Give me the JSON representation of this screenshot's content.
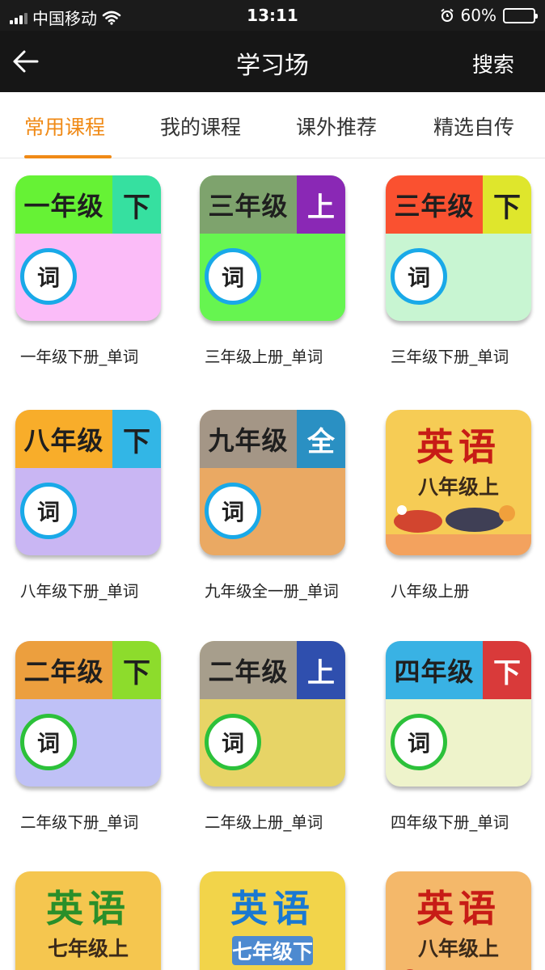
{
  "status_bar": {
    "carrier": "中国移动",
    "time": "13:11",
    "battery_text": "60%",
    "battery_level": 0.6,
    "battery_color": "#f6c100"
  },
  "nav": {
    "back_icon": "arrow-left-icon",
    "title": "学习场",
    "search_label": "搜索"
  },
  "tabs": [
    {
      "label": "常用课程",
      "active": true
    },
    {
      "label": "我的课程",
      "active": false
    },
    {
      "label": "课外推荐",
      "active": false
    },
    {
      "label": "精选自传",
      "active": false
    }
  ],
  "accent_color": "#f08a16",
  "courses": [
    {
      "label": "一年级下册_单词",
      "cover_type": "vocab",
      "grade": "一年级",
      "term": "下",
      "word": "词"
    },
    {
      "label": "三年级上册_单词",
      "cover_type": "vocab",
      "grade": "三年级",
      "term": "上",
      "word": "词"
    },
    {
      "label": "三年级下册_单词",
      "cover_type": "vocab",
      "grade": "三年级",
      "term": "下",
      "word": "词"
    },
    {
      "label": "八年级下册_单词",
      "cover_type": "vocab",
      "grade": "八年级",
      "term": "下",
      "word": "词"
    },
    {
      "label": "九年级全一册_单词",
      "cover_type": "vocab",
      "grade": "九年级",
      "term": "全",
      "word": "词"
    },
    {
      "label": "八年级上册",
      "cover_type": "textbook",
      "title": "英语",
      "subtitle": "八年级上"
    },
    {
      "label": "二年级下册_单词",
      "cover_type": "vocab",
      "grade": "二年级",
      "term": "下",
      "word": "词"
    },
    {
      "label": "二年级上册_单词",
      "cover_type": "vocab",
      "grade": "二年级",
      "term": "上",
      "word": "词"
    },
    {
      "label": "四年级下册_单词",
      "cover_type": "vocab",
      "grade": "四年级",
      "term": "下",
      "word": "词"
    },
    {
      "label": "",
      "cover_type": "textbook",
      "title": "英语",
      "subtitle": "七年级上"
    },
    {
      "label": "",
      "cover_type": "textbook",
      "title": "英语",
      "subtitle": "七年级下"
    },
    {
      "label": "",
      "cover_type": "textbook",
      "title": "英语",
      "subtitle": "八年级上"
    }
  ]
}
